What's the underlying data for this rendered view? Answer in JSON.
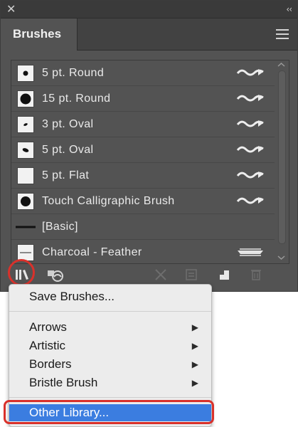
{
  "panel": {
    "close_glyph": "✕",
    "collapse_glyph": "‹‹",
    "tab_title": "Brushes",
    "menu_icon": "hamburger-menu-icon"
  },
  "brushes": [
    {
      "label": "5 pt. Round",
      "type": "calligraphic"
    },
    {
      "label": "15 pt. Round",
      "type": "calligraphic"
    },
    {
      "label": "3 pt. Oval",
      "type": "calligraphic"
    },
    {
      "label": "5 pt. Oval",
      "type": "calligraphic"
    },
    {
      "label": "5 pt. Flat",
      "type": "calligraphic"
    },
    {
      "label": "Touch Calligraphic Brush",
      "type": "calligraphic"
    },
    {
      "label": "[Basic]",
      "type": "basic"
    },
    {
      "label": "Charcoal - Feather",
      "type": "art"
    }
  ],
  "toolbar": {
    "buttons": [
      "brush-libraries-menu-icon",
      "libraries-panel-icon",
      "remove-brush-stroke-icon",
      "brush-options-icon",
      "new-brush-icon",
      "delete-brush-icon"
    ]
  },
  "popup": {
    "items": [
      {
        "label": "Save Brushes...",
        "submenu": false
      },
      {
        "label": "Arrows",
        "submenu": true
      },
      {
        "label": "Artistic",
        "submenu": true
      },
      {
        "label": "Borders",
        "submenu": true
      },
      {
        "label": "Bristle Brush",
        "submenu": true
      },
      {
        "label": "Other Library...",
        "submenu": false,
        "selected": true
      }
    ],
    "submenu_arrow": "▶"
  },
  "colors": {
    "panel_bg": "#535353",
    "highlight_red": "#d9312b",
    "menu_selection": "#3b7de0"
  }
}
